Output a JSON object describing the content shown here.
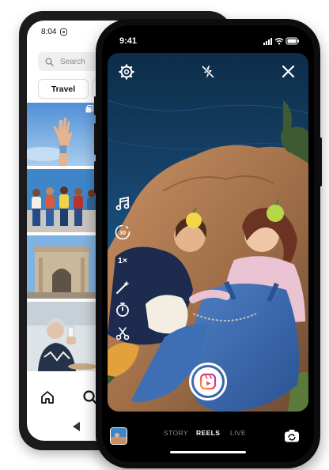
{
  "back_phone": {
    "status_time": "8:04",
    "search_placeholder": "Search",
    "category_chip": "Travel"
  },
  "front_phone": {
    "status_time": "9:41",
    "camera": {
      "top_icons": [
        "settings-icon",
        "flash-off-icon",
        "close-icon"
      ],
      "side_tools": [
        {
          "name": "audio-icon",
          "label": ""
        },
        {
          "name": "length-icon",
          "label": "30"
        },
        {
          "name": "speed",
          "label": "1×"
        },
        {
          "name": "effects-icon",
          "label": ""
        },
        {
          "name": "timer-icon",
          "label": ""
        },
        {
          "name": "align-icon",
          "label": ""
        }
      ]
    },
    "modes": {
      "story": "STORY",
      "reels": "REELS",
      "live": "LIVE"
    },
    "active_mode": "REELS",
    "colors": {
      "accent_reels": "#ff5a7d",
      "frame": "#0d0d0f"
    }
  }
}
